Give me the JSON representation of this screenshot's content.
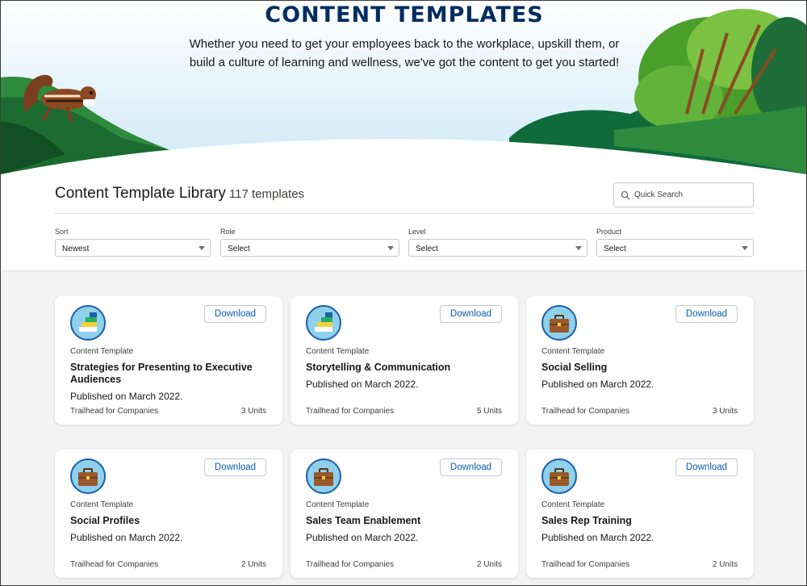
{
  "hero": {
    "title": "CONTENT TEMPLATES",
    "subtitle": "Whether you need to get your employees back to the workplace, upskill them, or build a culture of learning and wellness, we've got the content to get you started!"
  },
  "library": {
    "title": "Content Template Library",
    "count": "117 templates",
    "search_placeholder": "Quick Search"
  },
  "filters": [
    {
      "label": "Sort",
      "value": "Newest"
    },
    {
      "label": "Role",
      "value": "Select"
    },
    {
      "label": "Level",
      "value": "Select"
    },
    {
      "label": "Product",
      "value": "Select"
    }
  ],
  "cards": [
    {
      "icon": "stairs-icon",
      "download": "Download",
      "type": "Content Template",
      "title": "Strategies for Presenting to Executive Audiences",
      "published": "Published on March 2022.",
      "org": "Trailhead for Companies",
      "units": "3 Units"
    },
    {
      "icon": "stairs-icon",
      "download": "Download",
      "type": "Content Template",
      "title": "Storytelling & Communication",
      "published": "Published on March 2022.",
      "org": "Trailhead for Companies",
      "units": "5 Units"
    },
    {
      "icon": "briefcase-icon",
      "download": "Download",
      "type": "Content Template",
      "title": "Social Selling",
      "published": "Published on March 2022.",
      "org": "Trailhead for Companies",
      "units": "3 Units"
    },
    {
      "icon": "briefcase-icon",
      "download": "Download",
      "type": "Content Template",
      "title": "Social Profiles",
      "published": "Published on March 2022.",
      "org": "Trailhead for Companies",
      "units": "2 Units"
    },
    {
      "icon": "briefcase-icon",
      "download": "Download",
      "type": "Content Template",
      "title": "Sales Team Enablement",
      "published": "Published on March 2022.",
      "org": "Trailhead for Companies",
      "units": "2 Units"
    },
    {
      "icon": "briefcase-icon",
      "download": "Download",
      "type": "Content Template",
      "title": "Sales Rep Training",
      "published": "Published on March 2022.",
      "org": "Trailhead for Companies",
      "units": "2 Units"
    }
  ]
}
